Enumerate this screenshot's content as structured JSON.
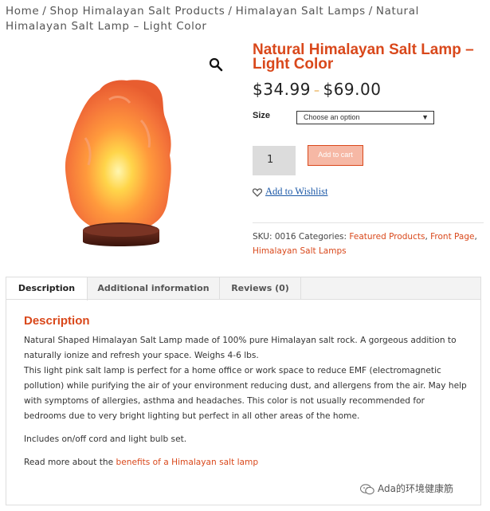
{
  "breadcrumb": {
    "home": "Home",
    "sep": "/",
    "shop": "Shop Himalayan Salt Products",
    "category": "Himalayan Salt Lamps",
    "current": "Natural Himalayan Salt Lamp – Light Color"
  },
  "product": {
    "title": "Natural Himalayan Salt Lamp – Light Color",
    "price_low": "$34.99",
    "price_dash": "–",
    "price_high": "$69.00",
    "size_label": "Size",
    "size_placeholder": "Choose an option",
    "quantity": "1",
    "add_to_cart": "Add to cart",
    "wishlist": "Add to Wishlist"
  },
  "meta": {
    "sku_label": "SKU:",
    "sku": "0016",
    "categories_label": "Categories:",
    "categories": [
      "Featured Products",
      "Front Page",
      "Himalayan Salt Lamps"
    ]
  },
  "tabs": [
    {
      "label": "Description",
      "active": true
    },
    {
      "label": "Additional information",
      "active": false
    },
    {
      "label": "Reviews (0)",
      "active": false
    }
  ],
  "description": {
    "heading": "Description",
    "p1": "Natural Shaped Himalayan Salt Lamp made of 100% pure Himalayan salt rock. A gorgeous addition to naturally ionize and refresh your space. Weighs 4-6 lbs.",
    "p2": "This light pink salt lamp is perfect for a home office or work space to reduce EMF (electromagnetic pollution) while purifying the air of your environment reducing dust, and allergens from the air. May help with symptoms of allergies, asthma and headaches. This color is not usually recommended for bedrooms due to very bright lighting but perfect in all other areas of the home.",
    "p3": "Includes on/off cord and light bulb set.",
    "p4_prefix": "Read more about the",
    "p4_link": "benefits of a Himalayan salt lamp"
  },
  "watermark": "Ada的环境健康筋",
  "colors": {
    "accent": "#d9481b",
    "cart_bg": "#f6b8a5",
    "link_blue": "#1e5aa8",
    "tab_bg": "#f3f3f3"
  },
  "icons": {
    "zoom": "magnifier-icon",
    "heart": "heart-icon",
    "select_arrow": "triangle-down-icon",
    "watermark_logo": "wechat-icon"
  }
}
